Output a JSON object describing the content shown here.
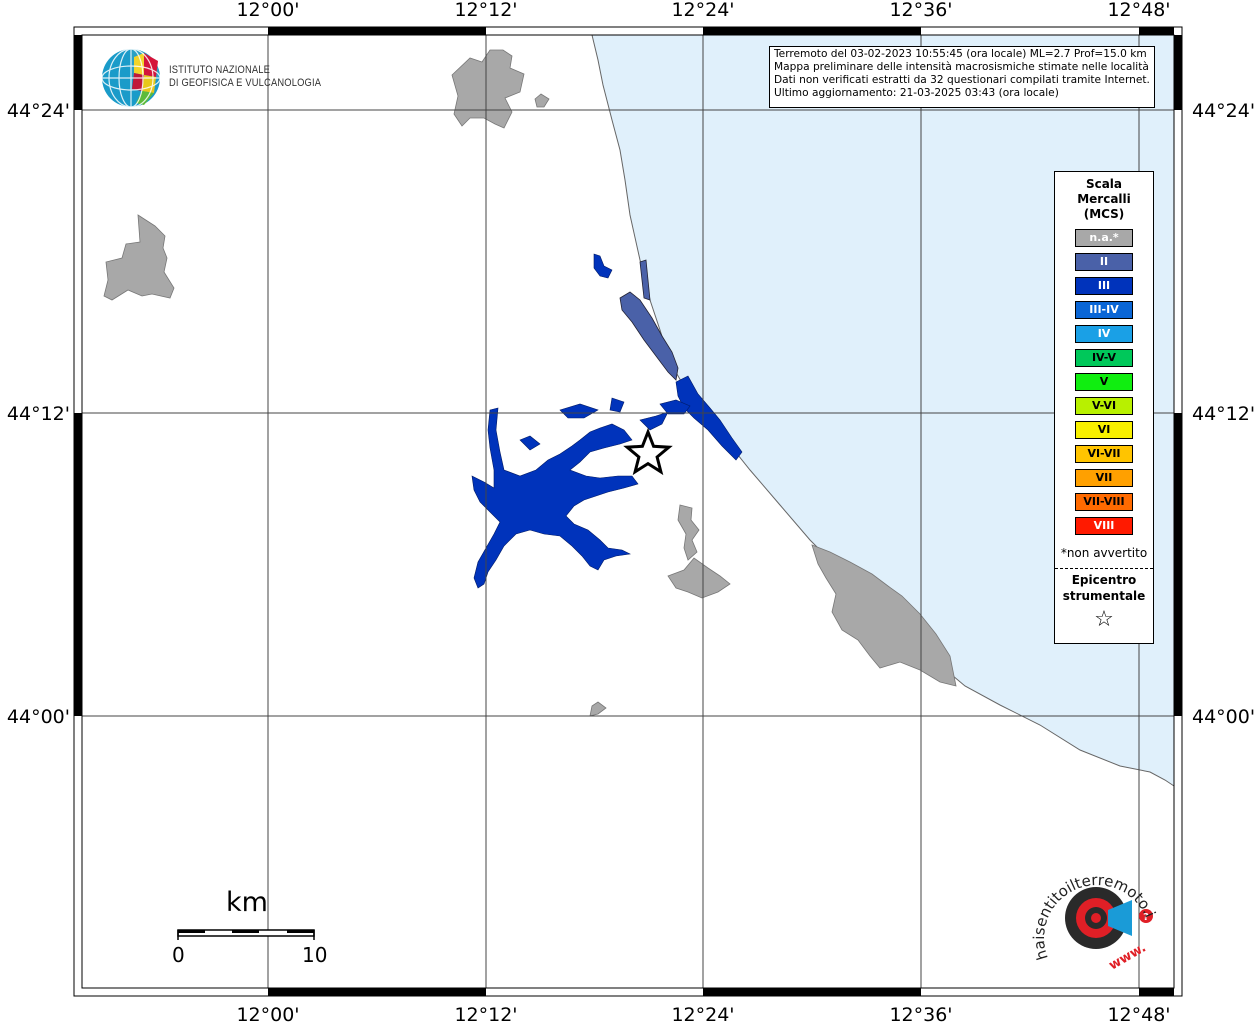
{
  "map": {
    "lon_ticks": [
      "12°00'",
      "12°12'",
      "12°24'",
      "12°36'",
      "12°48'"
    ],
    "lat_ticks": [
      "44°24'",
      "44°12'",
      "44°00'"
    ],
    "sea_color": "#e0f0fb",
    "land_color": "#ffffff",
    "grey_area_color": "#a8a8a8",
    "intensity_II_color": "#4a61a8",
    "intensity_III_color": "#0033bb"
  },
  "institute": {
    "line1": "ISTITUTO NAZIONALE",
    "line2": "DI GEOFISICA E VULCANOLOGIA"
  },
  "info": {
    "line1": "Terremoto del 03-02-2023 10:55:45 (ora locale) ML=2.7 Prof=15.0 km",
    "line2": "Mappa preliminare delle intensità macrosismiche stimate nelle località",
    "line3": "Dati non verificati estratti da 32 questionari compilati tramite Internet.",
    "line4": "Ultimo aggiornamento: 21-03-2025 03:43 (ora locale)"
  },
  "legend": {
    "title1": "Scala",
    "title2": "Mercalli",
    "title3": "(MCS)",
    "items": [
      {
        "label": "n.a.*",
        "color": "#a8a8a8",
        "text_color": "#ffffff"
      },
      {
        "label": "II",
        "color": "#4a61a8",
        "text_color": "#ffffff"
      },
      {
        "label": "III",
        "color": "#0033bb",
        "text_color": "#ffffff"
      },
      {
        "label": "III-IV",
        "color": "#0a66d6",
        "text_color": "#ffffff"
      },
      {
        "label": "IV",
        "color": "#1aa0e6",
        "text_color": "#ffffff"
      },
      {
        "label": "IV-V",
        "color": "#00c85a",
        "text_color": "#000000"
      },
      {
        "label": "V",
        "color": "#10ee10",
        "text_color": "#000000"
      },
      {
        "label": "V-VI",
        "color": "#b8f000",
        "text_color": "#000000"
      },
      {
        "label": "VI",
        "color": "#f8f000",
        "text_color": "#000000"
      },
      {
        "label": "VI-VII",
        "color": "#ffc400",
        "text_color": "#000000"
      },
      {
        "label": "VII",
        "color": "#ffa000",
        "text_color": "#000000"
      },
      {
        "label": "VII-VIII",
        "color": "#ff6a00",
        "text_color": "#000000"
      },
      {
        "label": "VIII",
        "color": "#ff1a00",
        "text_color": "#ffffff"
      }
    ],
    "note": "*non avvertito",
    "epi1": "Epicentro",
    "epi2": "strumentale",
    "star": "☆"
  },
  "scale_bar": {
    "unit": "km",
    "min": "0",
    "max": "10"
  },
  "hsit": {
    "text": "haisentitoilterremoto.it",
    "www": "www."
  }
}
